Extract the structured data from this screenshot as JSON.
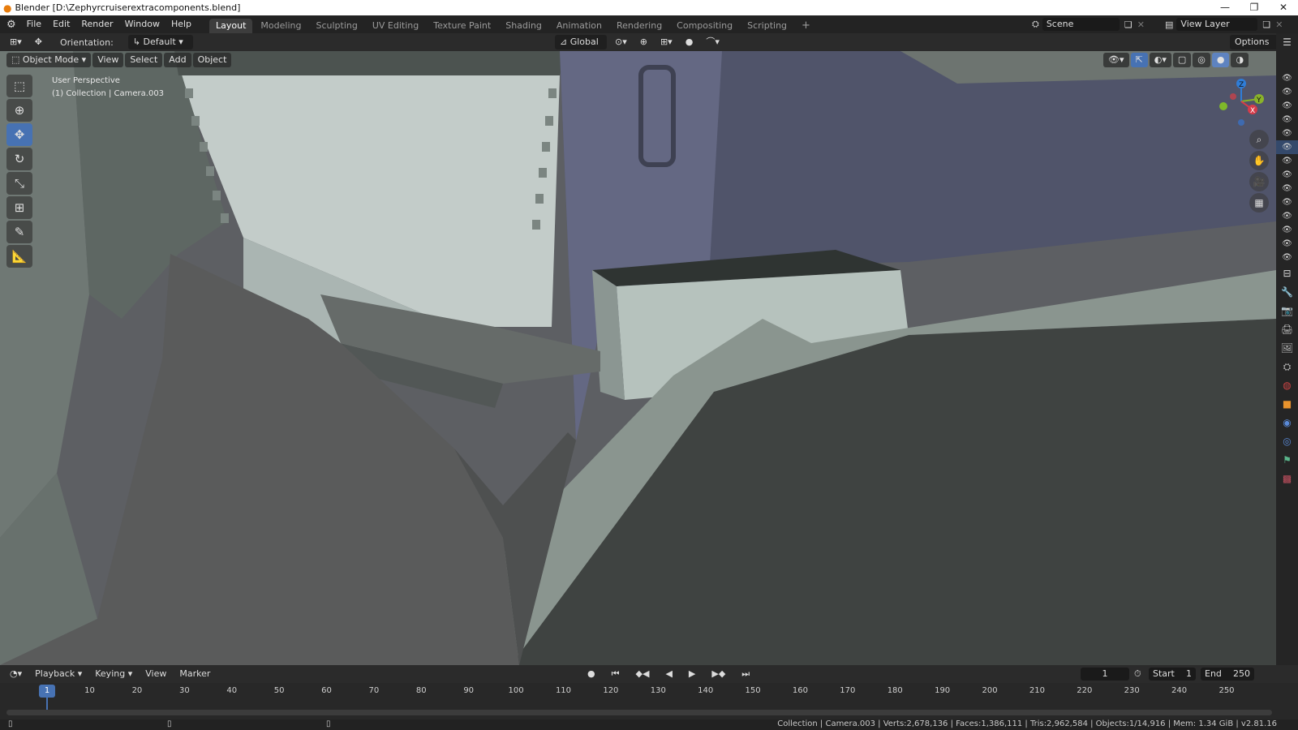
{
  "window": {
    "title": "Blender [D:\\Zephyrcruiserextracomponents.blend]"
  },
  "menu": [
    "File",
    "Edit",
    "Render",
    "Window",
    "Help"
  ],
  "workspaces": [
    "Layout",
    "Modeling",
    "Sculpting",
    "UV Editing",
    "Texture Paint",
    "Shading",
    "Animation",
    "Rendering",
    "Compositing",
    "Scripting"
  ],
  "scene": {
    "name": "Scene",
    "view_layer": "View Layer"
  },
  "header": {
    "orientation_label": "Orientation:",
    "orientation_value": "Default",
    "transform_space": "Global",
    "options": "Options"
  },
  "viewport": {
    "mode": "Object Mode",
    "menus": [
      "View",
      "Select",
      "Add",
      "Object"
    ],
    "perspective": "User Perspective",
    "collection": "(1) Collection | Camera.003",
    "gizmo": {
      "x": "X",
      "y": "Y",
      "z": "Z"
    }
  },
  "timeline": {
    "menus": [
      "Playback",
      "Keying",
      "View",
      "Marker"
    ],
    "current_frame": "1",
    "start_label": "Start",
    "start": "1",
    "end_label": "End",
    "end": "250",
    "ticks": [
      "1",
      "10",
      "20",
      "30",
      "40",
      "50",
      "60",
      "70",
      "80",
      "90",
      "100",
      "110",
      "120",
      "130",
      "140",
      "150",
      "160",
      "170",
      "180",
      "190",
      "200",
      "210",
      "220",
      "230",
      "240",
      "250"
    ]
  },
  "status": {
    "text": "Collection | Camera.003 | Verts:2,678,136 | Faces:1,386,111 | Tris:2,962,584 | Objects:1/14,916 | Mem: 1.34 GiB | v2.81.16"
  },
  "colors": {
    "accent": "#4772b3",
    "active_frame": "#4772b3"
  }
}
